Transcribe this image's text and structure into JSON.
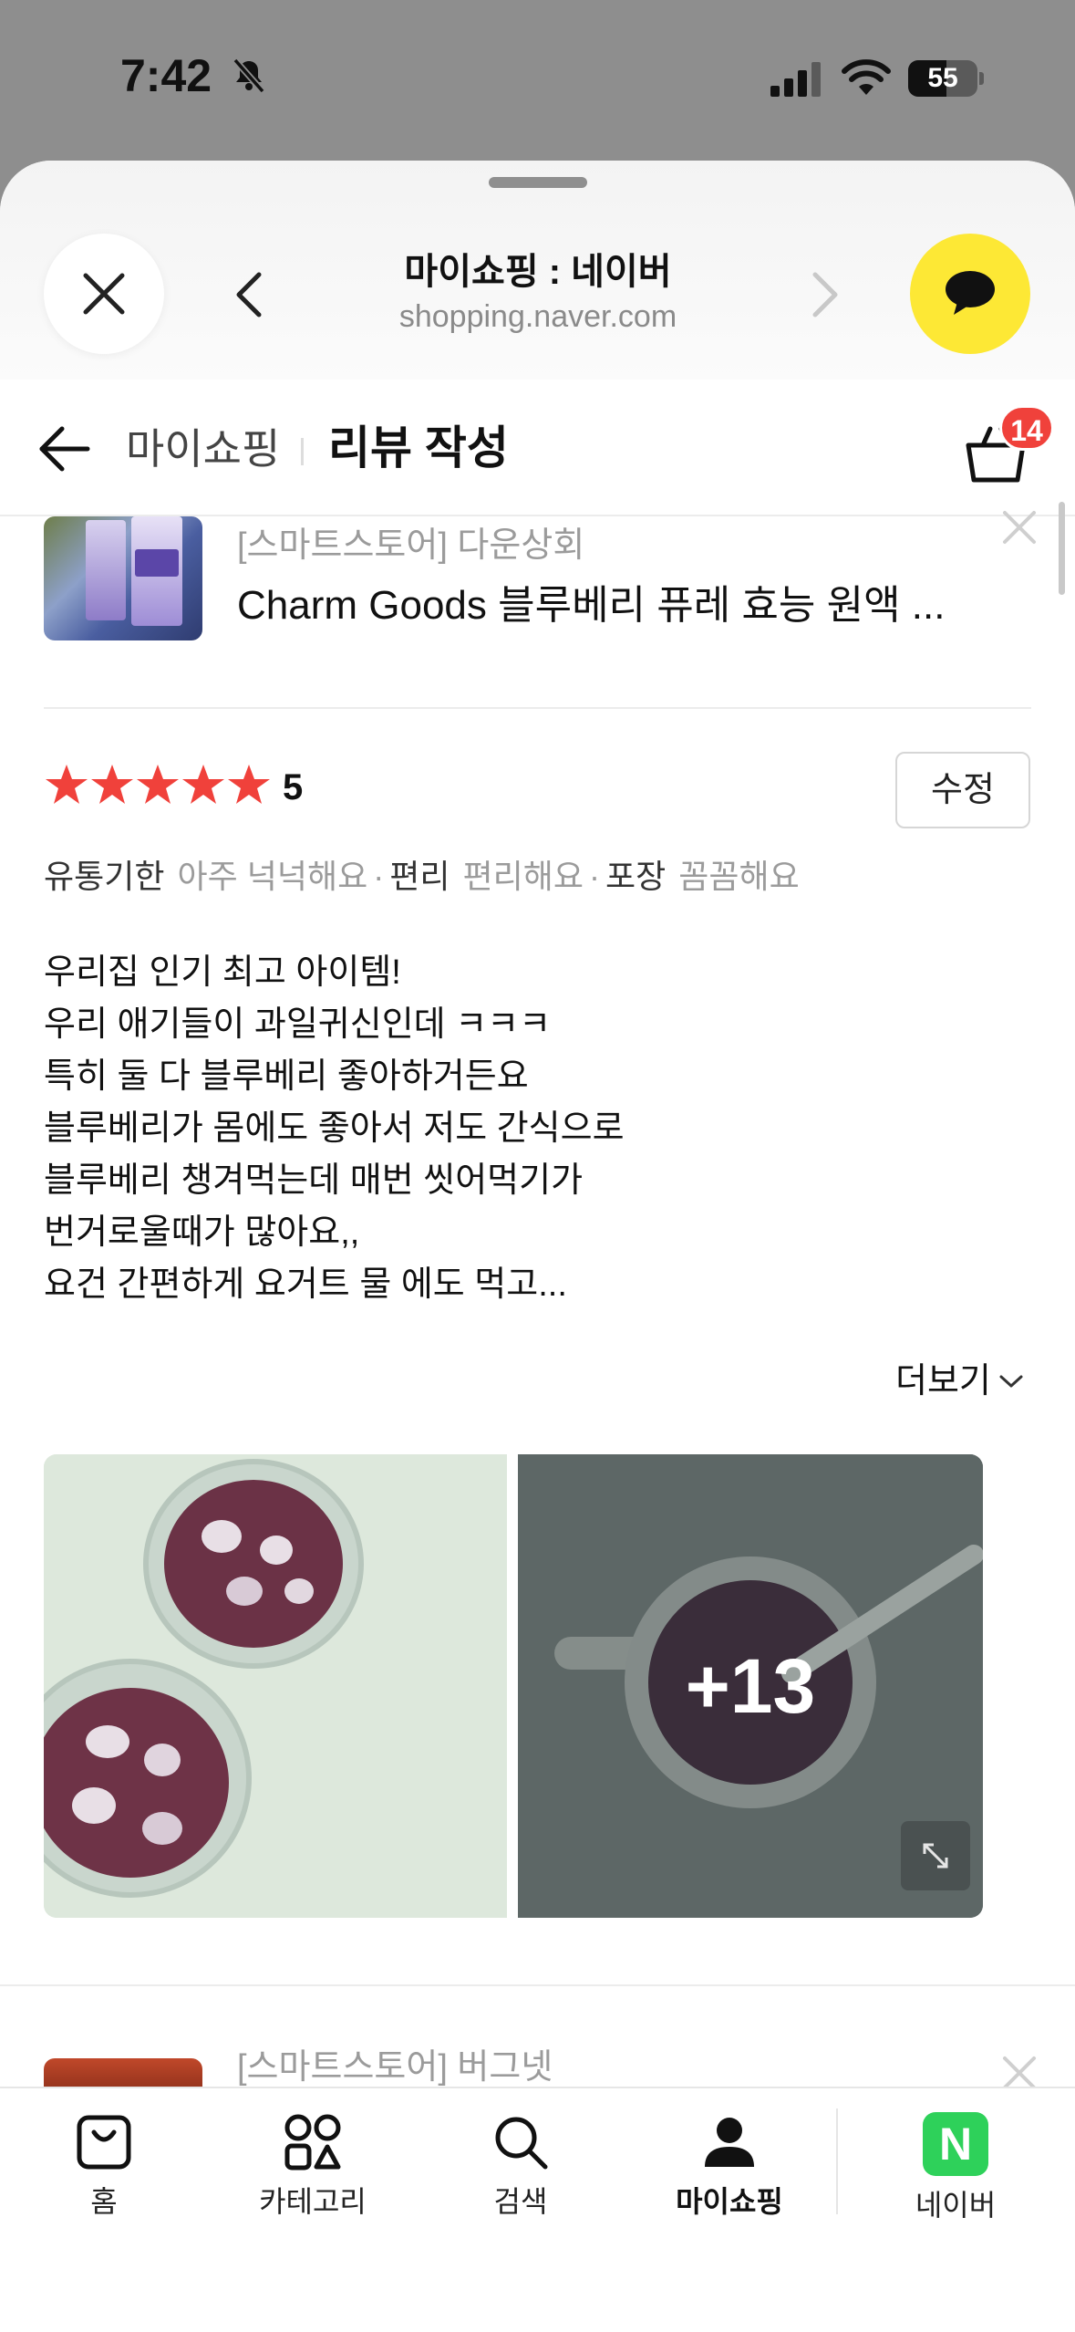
{
  "status_bar": {
    "time": "7:42",
    "battery_level": "55"
  },
  "browser": {
    "title": "마이쇼핑 : 네이버",
    "domain": "shopping.naver.com"
  },
  "header": {
    "breadcrumb": "마이쇼핑",
    "title": "리뷰 작성",
    "cart_count": "14"
  },
  "product": {
    "store": "[스마트스토어] 다운상회",
    "name": "Charm Goods 블루베리 퓨레 효능 원액 ..."
  },
  "review": {
    "rating": "5",
    "edit_label": "수정",
    "attributes": [
      {
        "key": "유통기한",
        "value": "아주 넉넉해요"
      },
      {
        "key": "편리",
        "value": "편리해요"
      },
      {
        "key": "포장",
        "value": "꼼꼼해요"
      }
    ],
    "text_lines": [
      "우리집 인기 최고 아이템!",
      "우리 애기들이 과일귀신인데 ㅋㅋㅋ",
      "특히 둘 다 블루베리 좋아하거든요",
      "블루베리가 몸에도 좋아서 저도 간식으로",
      "블루베리 챙겨먹는데 매번 씻어먹기가",
      "번거로울때가 많아요,,",
      "요건 간편하게 요거트 물 에도 먹고..."
    ],
    "more_label": "더보기",
    "extra_photos": "+13"
  },
  "next_item": {
    "store": "[스마트스토어] 버그넷"
  },
  "tabbar": {
    "items": [
      {
        "label": "홈",
        "icon": "bag-icon"
      },
      {
        "label": "카테고리",
        "icon": "category-icon"
      },
      {
        "label": "검색",
        "icon": "search-icon"
      },
      {
        "label": "마이쇼핑",
        "icon": "person-icon"
      },
      {
        "label": "네이버",
        "icon": "naver-logo"
      }
    ]
  },
  "colors": {
    "star": "#f0413b",
    "badge": "#f0413b",
    "talk": "#fde835",
    "naver_green": "#2ed15a"
  }
}
